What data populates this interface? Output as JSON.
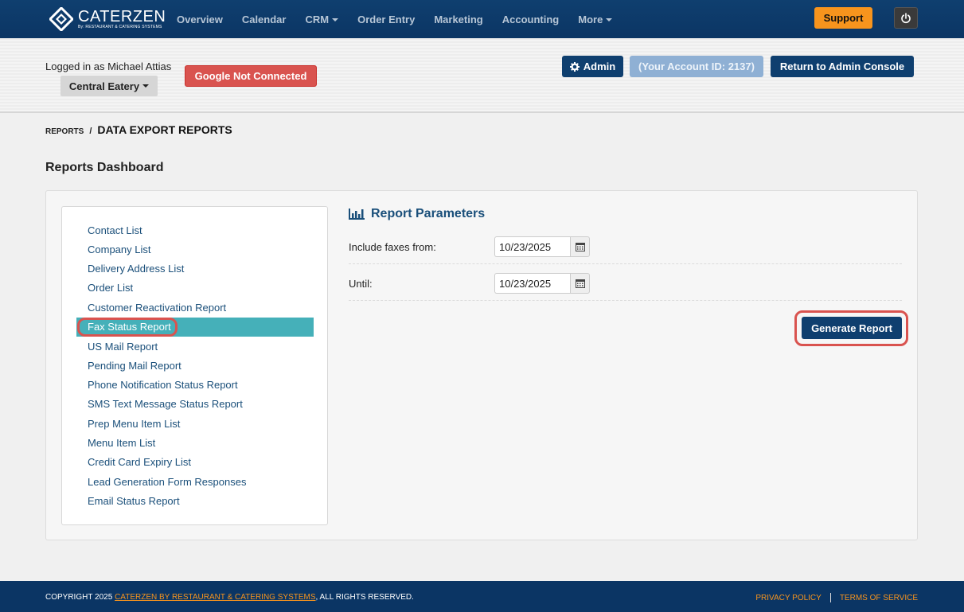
{
  "brand": {
    "name": "CaterZen",
    "tagline": "By: RESTAURANT & CATERING SYSTEMS"
  },
  "nav": {
    "items": [
      {
        "label": "Overview",
        "dropdown": false
      },
      {
        "label": "Calendar",
        "dropdown": false
      },
      {
        "label": "CRM",
        "dropdown": true
      },
      {
        "label": "Order Entry",
        "dropdown": false
      },
      {
        "label": "Marketing",
        "dropdown": false
      },
      {
        "label": "Accounting",
        "dropdown": false
      },
      {
        "label": "More",
        "dropdown": true
      }
    ],
    "support_label": "Support",
    "power_icon": "power-icon"
  },
  "subheader": {
    "logged_in_text": "Logged in as Michael Attias",
    "location_label": "Central Eatery",
    "google_label": "Google Not Connected",
    "admin_label": "Admin",
    "account_id_label": "(Your Account ID: 2137)",
    "return_label": "Return to Admin Console"
  },
  "breadcrumb": {
    "root": "REPORTS",
    "separator": "/",
    "current": "DATA EXPORT REPORTS"
  },
  "page_title": "Reports Dashboard",
  "reports": {
    "items": [
      "Contact List",
      "Company List",
      "Delivery Address List",
      "Order List",
      "Customer Reactivation Report",
      "Fax Status Report",
      "US Mail Report",
      "Pending Mail Report",
      "Phone Notification Status Report",
      "SMS Text Message Status Report",
      "Prep Menu Item List",
      "Menu Item List",
      "Credit Card Expiry List",
      "Lead Generation Form Responses",
      "Email Status Report"
    ],
    "active_index": 5
  },
  "params": {
    "title": "Report Parameters",
    "from_label": "Include faxes from:",
    "from_value": "10/23/2025",
    "until_label": "Until:",
    "until_value": "10/23/2025",
    "generate_label": "Generate Report"
  },
  "footer": {
    "copyright_prefix": "COPYRIGHT 2025",
    "copyright_link": "CATERZEN BY RESTAURANT & CATERING SYSTEMS",
    "copyright_suffix": ", ALL RIGHTS RESERVED.",
    "privacy_label": "PRIVACY POLICY",
    "terms_label": "TERMS OF SERVICE"
  },
  "colors": {
    "nav_bg": "#0f3f6f",
    "support": "#f7941d",
    "danger": "#d9534f",
    "active_item": "#45b0b9",
    "link": "#1a4f7a"
  }
}
